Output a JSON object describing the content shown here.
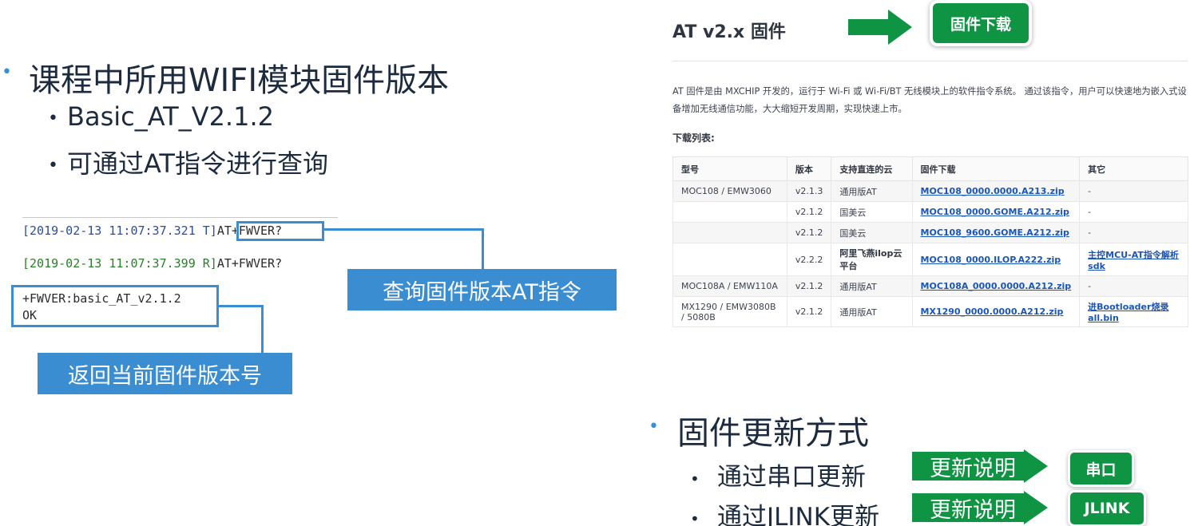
{
  "left": {
    "title": "课程中所用WIFI模块固件版本",
    "bullets": [
      "Basic_AT_V2.1.2",
      "可通过AT指令进行查询"
    ],
    "log": {
      "line1_ts": "[2019-02-13 11:07:37.321 T]",
      "line1_cmd": "AT+FWVER?",
      "line2_ts": "[2019-02-13 11:07:37.399 R]",
      "line2_cmd": "AT+FWVER?",
      "response": "+FWVER:basic_AT_v2.1.2\nOK"
    },
    "callout_query": "查询固件版本AT指令",
    "callout_return": "返回当前固件版本号"
  },
  "web": {
    "title": "AT v2.x 固件",
    "download_button": "固件下载",
    "description": "AT 固件是由 MXCHIP 开发的，运行于 Wi-Fi 或 Wi-Fi/BT 无线模块上的软件指令系统。 通过该指令，用户可以快速地为嵌入式设备增加无线通信功能，大大缩短开发周期，实现快速上市。",
    "list_title": "下载列表:",
    "columns": [
      "型号",
      "版本",
      "支持直连的云",
      "固件下载",
      "其它"
    ],
    "rows": [
      {
        "model": "MOC108 / EMW3060",
        "ver": "v2.1.3",
        "cloud": "通用版AT",
        "fw": "MOC108_0000.0000.A213.zip",
        "other": "-"
      },
      {
        "model": "",
        "ver": "v2.1.2",
        "cloud": "国美云",
        "fw": "MOC108_0000.GOME.A212.zip",
        "other": "-"
      },
      {
        "model": "",
        "ver": "v2.1.2",
        "cloud": "国美云",
        "fw": "MOC108_9600.GOME.A212.zip",
        "other": "-"
      },
      {
        "model": "",
        "ver": "v2.2.2",
        "cloud": "阿里飞燕ilop云平台",
        "fw": "MOC108_0000.ILOP.A222.zip",
        "other": "主控MCU-AT指令解析sdk"
      },
      {
        "model": "MOC108A / EMW110A",
        "ver": "v2.1.2",
        "cloud": "通用版AT",
        "fw": "MOC108A_0000.0000.A212.zip",
        "other": "-"
      },
      {
        "model": "MX1290 / EMW3080B / 5080B",
        "ver": "v2.1.2",
        "cloud": "通用版AT",
        "fw": "MX1290_0000.0000.A212.zip",
        "other": "进Bootloader烧录all.bin"
      }
    ]
  },
  "update": {
    "title": "固件更新方式",
    "items": [
      {
        "label": "通过串口更新",
        "banner": "更新说明",
        "button": "串口"
      },
      {
        "label": "通过JLINK更新",
        "banner": "更新说明",
        "button": "JLINK"
      }
    ]
  },
  "colors": {
    "accent_blue": "#3b8dd1",
    "brand_green": "#0f9443",
    "link_blue": "#1a56b8"
  }
}
